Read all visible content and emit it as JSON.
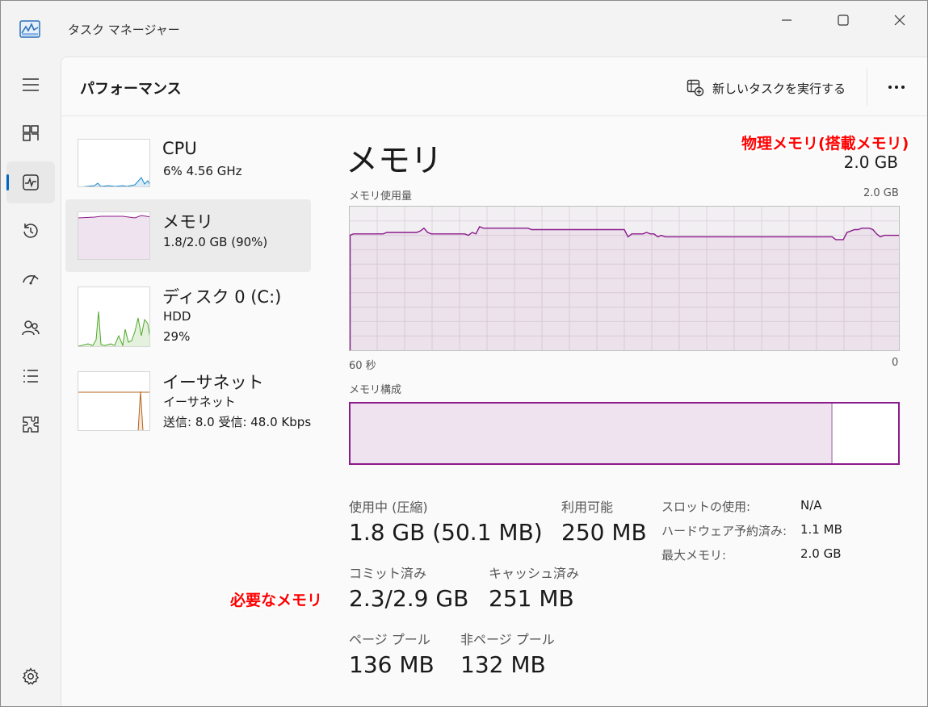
{
  "window": {
    "title": "タスク マネージャー"
  },
  "nav": {
    "items": [
      {
        "icon": "hamburger-menu-icon"
      },
      {
        "icon": "processes-icon"
      },
      {
        "icon": "performance-icon",
        "active": true
      },
      {
        "icon": "app-history-icon"
      },
      {
        "icon": "startup-apps-icon"
      },
      {
        "icon": "users-icon"
      },
      {
        "icon": "details-icon"
      },
      {
        "icon": "services-icon"
      },
      {
        "icon": "settings-icon"
      }
    ]
  },
  "header": {
    "title": "パフォーマンス",
    "run_task_label": "新しいタスクを実行する"
  },
  "resources": [
    {
      "title": "CPU",
      "line1": "6%  4.56 GHz",
      "line2": "",
      "line3": "",
      "color": "#1a86c9"
    },
    {
      "title": "メモリ",
      "line1": "1.8/2.0 GB (90%)",
      "line2": "",
      "line3": "",
      "color": "#8b1a8b"
    },
    {
      "title": "ディスク 0 (C:)",
      "line1": "HDD",
      "line2": "29%",
      "line3": "",
      "color": "#4fa82b"
    },
    {
      "title": "イーサネット",
      "line1": "イーサネット",
      "line2": "送信: 8.0  受信: 48.0 Kbps",
      "line3": "",
      "color": "#b5651d"
    }
  ],
  "detail": {
    "title": "メモリ",
    "total": "2.0 GB",
    "annotation_physical": "物理メモリ(搭載メモリ)",
    "annotation_required": "必要なメモリ",
    "usage_label": "メモリ使用量",
    "usage_max": "2.0 GB",
    "time_left": "60 秒",
    "time_right": "0",
    "composition_label": "メモリ構成",
    "composition_used_fraction": 0.88,
    "stats": {
      "in_use_label": "使用中 (圧縮)",
      "in_use_value": "1.8 GB (50.1 MB)",
      "available_label": "利用可能",
      "available_value": "250 MB",
      "committed_label": "コミット済み",
      "committed_value": "2.3/2.9 GB",
      "cached_label": "キャッシュ済み",
      "cached_value": "251 MB",
      "paged_label": "ページ プール",
      "paged_value": "136 MB",
      "nonpaged_label": "非ページ プール",
      "nonpaged_value": "132 MB"
    },
    "specs": [
      {
        "key": "スロットの使用:",
        "value": "N/A"
      },
      {
        "key": "ハードウェア予約済み:",
        "value": "1.1 MB"
      },
      {
        "key": "最大メモリ:",
        "value": "2.0 GB"
      }
    ],
    "usage_series": [
      0.8,
      0.81,
      0.81,
      0.81,
      0.81,
      0.81,
      0.81,
      0.81,
      0.81,
      0.81,
      0.82,
      0.82,
      0.82,
      0.82,
      0.82,
      0.82,
      0.82,
      0.82,
      0.82,
      0.83,
      0.85,
      0.82,
      0.81,
      0.81,
      0.81,
      0.81,
      0.81,
      0.81,
      0.81,
      0.81,
      0.81,
      0.81,
      0.8,
      0.82,
      0.81,
      0.86,
      0.85,
      0.85,
      0.85,
      0.85,
      0.85,
      0.85,
      0.85,
      0.85,
      0.85,
      0.85,
      0.85,
      0.85,
      0.85,
      0.84,
      0.84,
      0.84,
      0.84,
      0.84,
      0.84,
      0.84,
      0.84,
      0.84,
      0.84,
      0.84,
      0.84,
      0.84,
      0.84,
      0.84,
      0.84,
      0.84,
      0.84,
      0.84,
      0.84,
      0.84,
      0.84,
      0.84,
      0.84,
      0.84,
      0.84,
      0.79,
      0.81,
      0.81,
      0.81,
      0.81,
      0.82,
      0.81,
      0.81,
      0.79,
      0.8,
      0.79,
      0.79,
      0.79,
      0.79,
      0.79,
      0.79,
      0.79,
      0.79,
      0.79,
      0.79,
      0.79,
      0.79,
      0.79,
      0.79,
      0.79,
      0.79,
      0.79,
      0.79,
      0.79,
      0.79,
      0.79,
      0.79,
      0.79,
      0.79,
      0.79,
      0.79,
      0.79,
      0.79,
      0.79,
      0.79,
      0.79,
      0.79,
      0.79,
      0.79,
      0.79,
      0.79,
      0.79,
      0.79,
      0.79,
      0.79,
      0.79,
      0.79,
      0.79,
      0.79,
      0.79,
      0.79,
      0.77,
      0.77,
      0.77,
      0.82,
      0.83,
      0.84,
      0.84,
      0.85,
      0.85,
      0.85,
      0.84,
      0.81,
      0.79,
      0.8,
      0.8,
      0.8,
      0.8,
      0.8
    ]
  }
}
